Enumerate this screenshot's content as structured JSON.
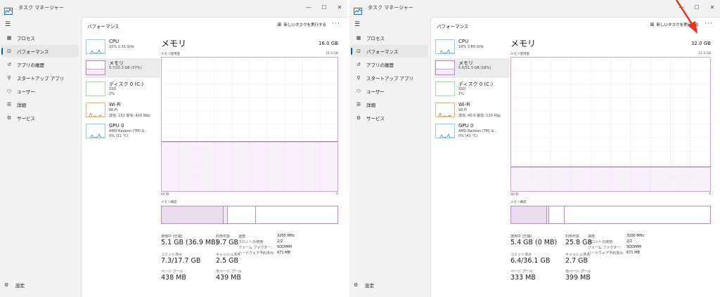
{
  "windows": [
    {
      "app_title": "タスク マネージャー",
      "nav": [
        {
          "label": "プロセス",
          "icon": "grid-icon"
        },
        {
          "label": "パフォーマンス",
          "icon": "performance-icon",
          "active": true
        },
        {
          "label": "アプリの履歴",
          "icon": "history-icon"
        },
        {
          "label": "スタートアップ アプリ",
          "icon": "startup-icon"
        },
        {
          "label": "ユーザー",
          "icon": "users-icon"
        },
        {
          "label": "詳細",
          "icon": "list-icon"
        },
        {
          "label": "サービス",
          "icon": "services-icon"
        }
      ],
      "settings_label": "設定",
      "content_title": "パフォーマンス",
      "run_task_label": "新しいタスクを実行する",
      "devices": [
        {
          "name": "CPU",
          "lines": [
            "10%  2.31 GHz"
          ]
        },
        {
          "name": "メモリ",
          "lines": [
            "5.7/15.3 GB (37%)"
          ],
          "active": true
        },
        {
          "name": "ディスク 0 (C:)",
          "lines": [
            "SSD",
            "2%"
          ]
        },
        {
          "name": "Wi-Fi",
          "lines": [
            "Wi-Fi",
            "送信: 152  受信: 416 Kbp"
          ]
        },
        {
          "name": "GPU 0",
          "lines": [
            "AMD Radeon (TM) G...",
            "0% (31 °C)"
          ]
        }
      ],
      "memory": {
        "title": "メモリ",
        "total": "16.0 GB",
        "usage_label": "メモリ使用量",
        "usage_max": "15.3 GB",
        "usage_fraction": 0.37,
        "axis_left": "60 秒",
        "axis_right": "0",
        "composition_label": "メモリ構成",
        "composition": {
          "in_use": 0.35,
          "modified": 0.025,
          "standby": 0.16
        },
        "stats": [
          {
            "label": "使用中 (圧縮)",
            "value": "5.1 GB (36.9 MB)"
          },
          {
            "label": "利用可能",
            "value": "9.7 GB"
          },
          {
            "label": "コミット済み",
            "value": "7.3/17.7 GB"
          },
          {
            "label": "キャッシュ済み",
            "value": "2.5 GB"
          },
          {
            "label": "ページ プール",
            "value": "438 MB"
          },
          {
            "label": "非ページ プール",
            "value": "439 MB"
          }
        ],
        "specs": [
          {
            "key": "速度:",
            "value": "3200 MHz"
          },
          {
            "key": "スロットの使用:",
            "value": "2/2"
          },
          {
            "key": "フォーム ファクター:",
            "value": "SODIMM"
          },
          {
            "key": "ハードウェア予約済み:",
            "value": "671 MB"
          }
        ]
      }
    },
    {
      "app_title": "タスク マネージャー",
      "nav": [
        {
          "label": "プロセス",
          "icon": "grid-icon"
        },
        {
          "label": "パフォーマンス",
          "icon": "performance-icon",
          "active": true
        },
        {
          "label": "アプリの履歴",
          "icon": "history-icon"
        },
        {
          "label": "スタートアップ アプリ",
          "icon": "startup-icon"
        },
        {
          "label": "ユーザー",
          "icon": "users-icon"
        },
        {
          "label": "詳細",
          "icon": "list-icon"
        },
        {
          "label": "サービス",
          "icon": "services-icon"
        }
      ],
      "settings_label": "設定",
      "content_title": "パフォーマンス",
      "run_task_label": "新しいタスクを実行する",
      "devices": [
        {
          "name": "CPU",
          "lines": [
            "19%  3.89 GHz"
          ]
        },
        {
          "name": "メモリ",
          "lines": [
            "5.6/31.3 GB (18%)"
          ],
          "active": true
        },
        {
          "name": "ディスク 0 (C:)",
          "lines": [
            "SSD",
            "1%"
          ]
        },
        {
          "name": "Wi-Fi",
          "lines": [
            "Wi-Fi",
            "送信: 40.0  受信: 120 Kbp"
          ]
        },
        {
          "name": "GPU 0",
          "lines": [
            "AMD Radeon (TM) G...",
            "0% (43 °C)"
          ]
        }
      ],
      "memory": {
        "title": "メモリ",
        "total": "32.0 GB",
        "usage_label": "メモリ使用量",
        "usage_max": "31.3 GB",
        "usage_fraction": 0.18,
        "axis_left": "60 秒",
        "axis_right": "0",
        "composition_label": "メモリ構成",
        "composition": {
          "in_use": 0.18,
          "modified": 0.01,
          "standby": 0.08
        },
        "stats": [
          {
            "label": "使用中 (圧縮)",
            "value": "5.4 GB (0 MB)"
          },
          {
            "label": "利用可能",
            "value": "25.8 GB"
          },
          {
            "label": "コミット済み",
            "value": "6.4/36.1 GB"
          },
          {
            "label": "キャッシュ済み",
            "value": "2.7 GB"
          },
          {
            "label": "ページ プール",
            "value": "333 MB"
          },
          {
            "label": "非ページ プール",
            "value": "399 MB"
          }
        ],
        "specs": [
          {
            "key": "速度:",
            "value": "3200 MHz"
          },
          {
            "key": "スロットの使用:",
            "value": "2/2"
          },
          {
            "key": "フォーム ファクター:",
            "value": "SODIMM"
          },
          {
            "key": "ハードウェア予約済み:",
            "value": "671 MB"
          }
        ]
      }
    }
  ],
  "colors": {
    "memory_purple": "#8b12ae",
    "memory_fill": "#f4ecf6",
    "grid": "#efe6f1",
    "accent": "#005fb8",
    "annotation_arrow": "#e8341c"
  }
}
